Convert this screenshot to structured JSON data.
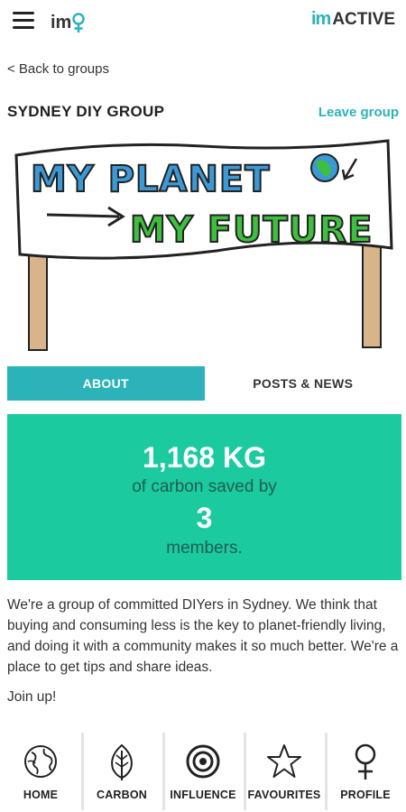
{
  "header": {
    "logo_small": "im",
    "brand_im": "im",
    "brand_active": "ACTIVE"
  },
  "nav": {
    "back_label": "< Back to groups"
  },
  "group": {
    "title": "SYDNEY DIY GROUP",
    "leave_label": "Leave group",
    "banner_line1": "MY PLANET",
    "banner_line2": "MY FUTURE"
  },
  "tabs": [
    {
      "label": "ABOUT",
      "active": true
    },
    {
      "label": "POSTS & NEWS",
      "active": false
    }
  ],
  "stats": {
    "carbon_value": "1,168 KG",
    "carbon_caption": "of carbon saved by",
    "members_value": "3",
    "members_caption": "members."
  },
  "about": {
    "description": "We're a group of committed DIYers in Sydney. We think that buying and consuming less is the key to planet-friendly living, and doing it with a community makes it so much better. We're a place to get tips and share ideas.",
    "join": "Join up!"
  },
  "bottom_nav": [
    {
      "label": "HOME",
      "icon": "globe-icon"
    },
    {
      "label": "CARBON",
      "icon": "leaf-icon"
    },
    {
      "label": "INFLUENCE",
      "icon": "target-icon"
    },
    {
      "label": "FAVOURITES",
      "icon": "star-icon"
    },
    {
      "label": "PROFILE",
      "icon": "female-symbol-icon"
    }
  ],
  "colors": {
    "accent": "#2bb3b9",
    "stats_bg": "#1ccaa0",
    "stats_caption": "#1f5e50",
    "banner_blue": "#3b9ad6",
    "banner_green": "#3fbf3f"
  }
}
